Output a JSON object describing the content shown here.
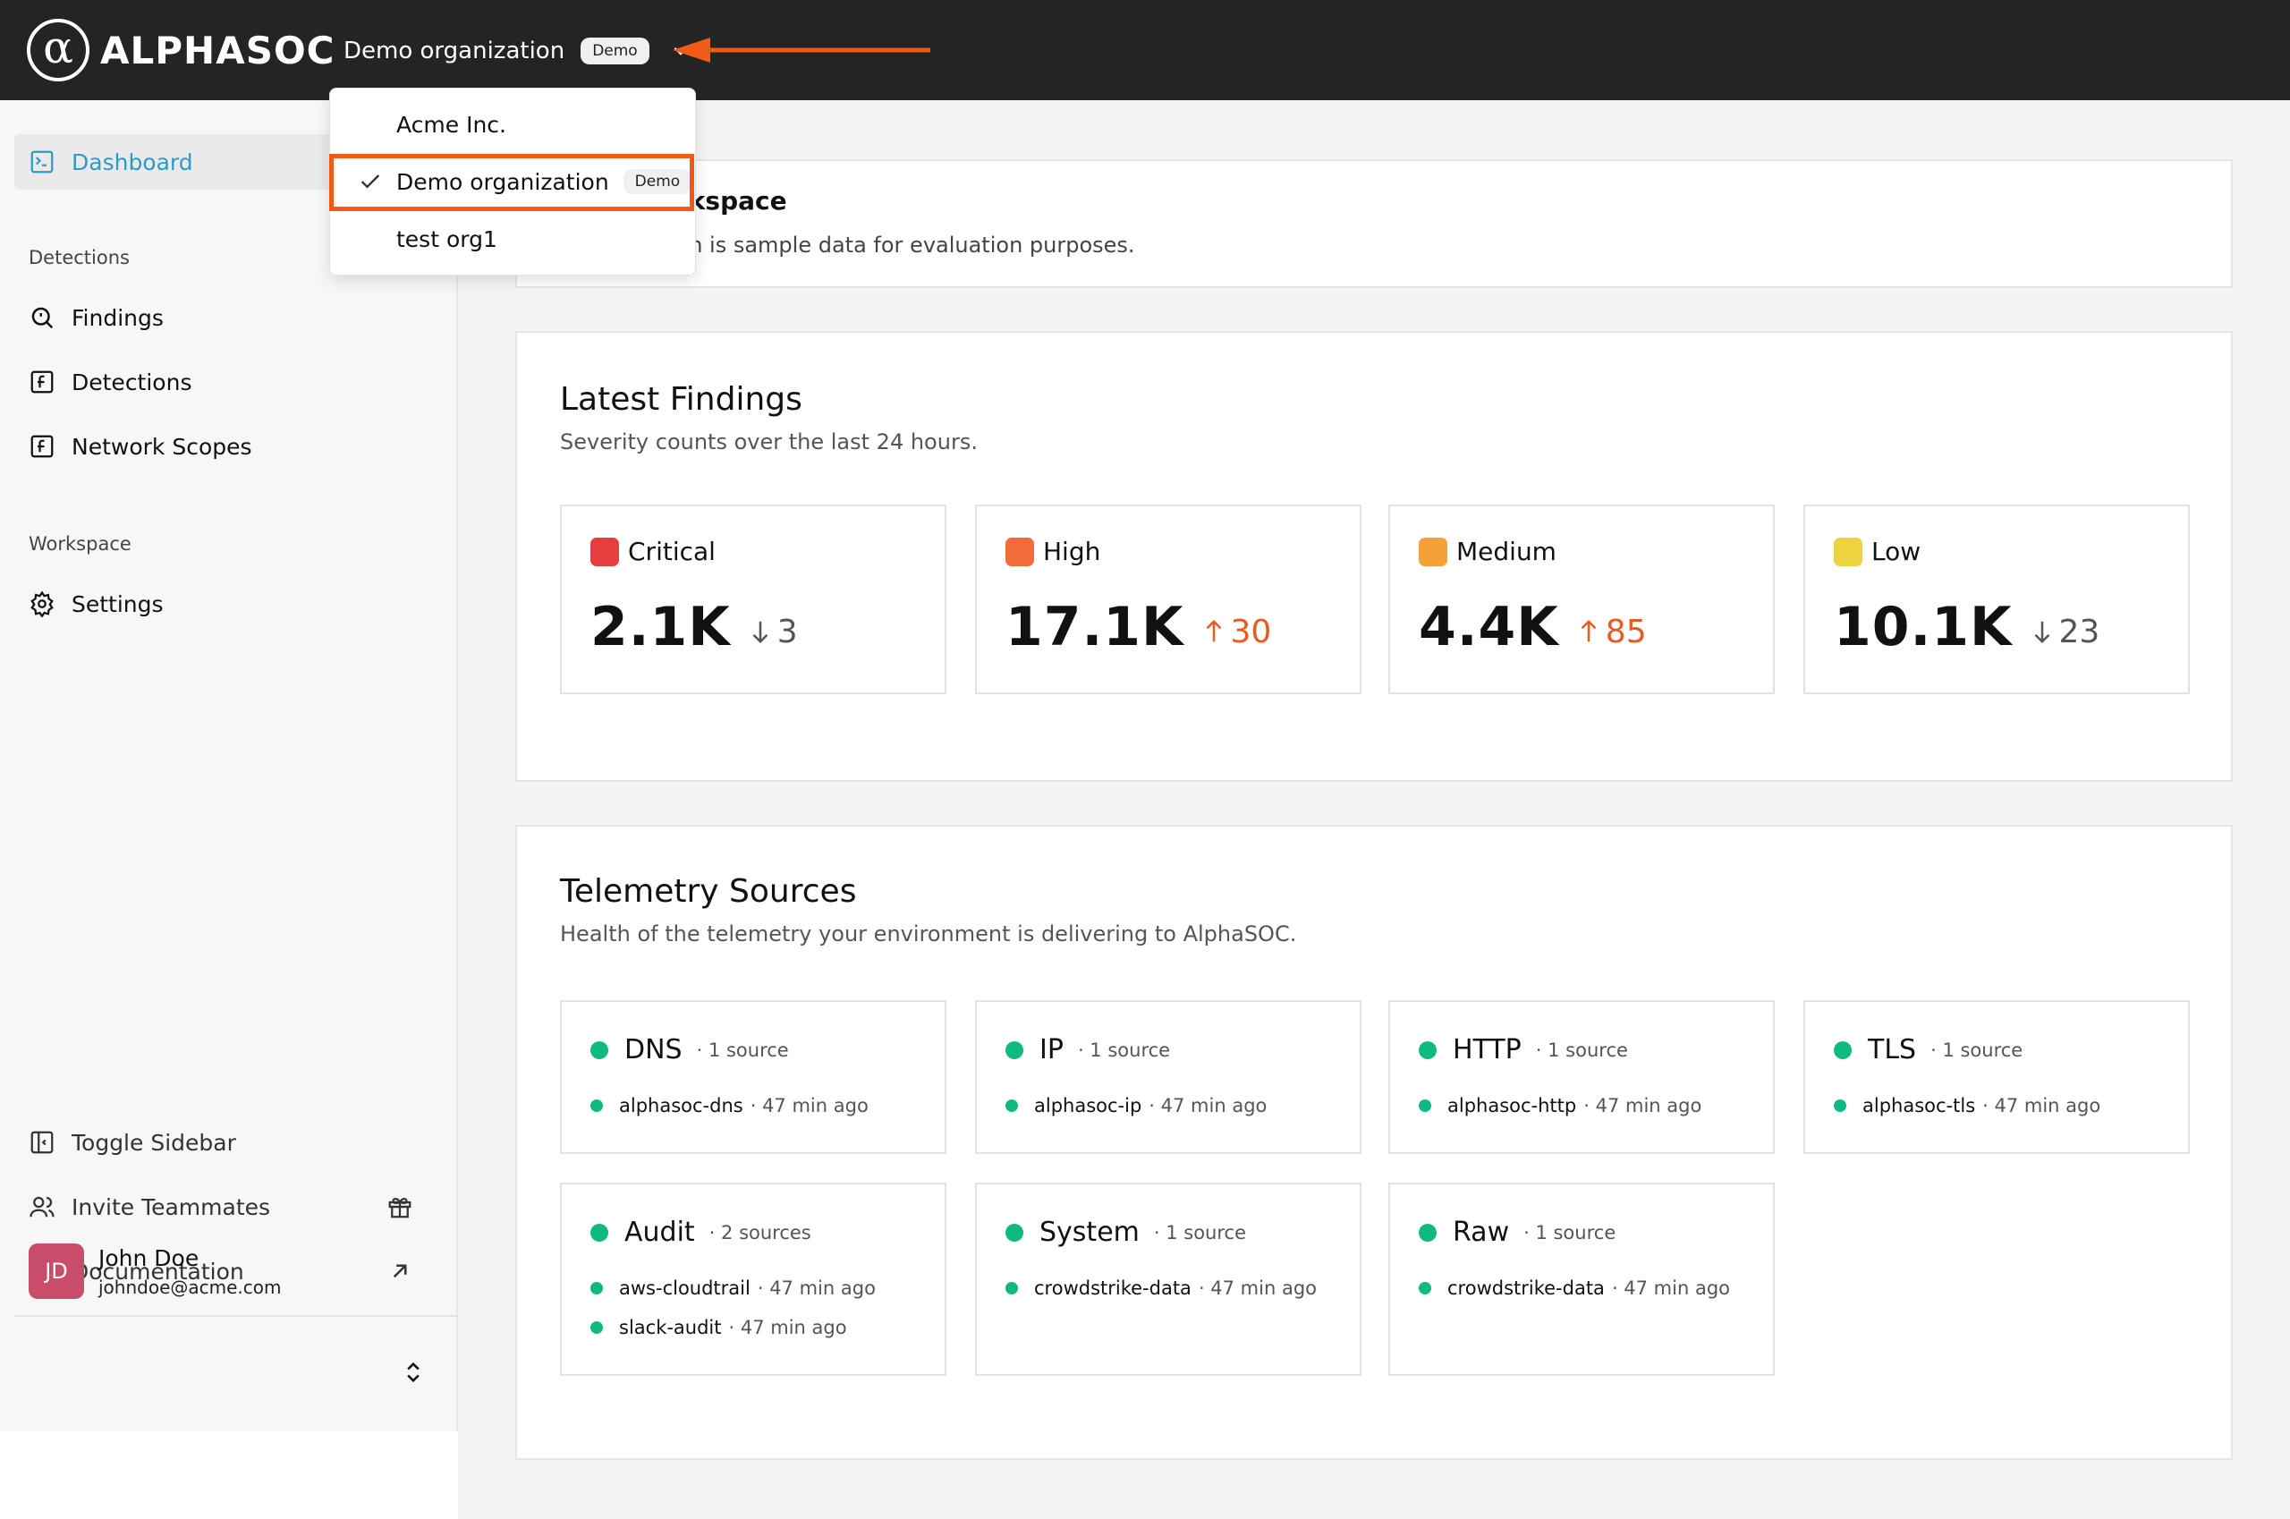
{
  "brand": {
    "name": "ALPHASOC",
    "mark": "α"
  },
  "header": {
    "org_name": "Demo organization",
    "org_badge": "Demo"
  },
  "org_dropdown": {
    "items": [
      {
        "label": "Acme Inc.",
        "badge": "",
        "selected": false
      },
      {
        "label": "Demo organization",
        "badge": "Demo",
        "selected": true
      },
      {
        "label": "test org1",
        "badge": "",
        "selected": false
      }
    ]
  },
  "sidebar": {
    "dashboard": "Dashboard",
    "section_detections": "Detections",
    "findings": "Findings",
    "detections": "Detections",
    "network_scopes": "Network Scopes",
    "section_workspace": "Workspace",
    "settings": "Settings",
    "toggle_sidebar": "Toggle Sidebar",
    "invite_teammates": "Invite Teammates",
    "documentation": "Documentation"
  },
  "user": {
    "initials": "JD",
    "name": "John Doe",
    "email": "johndoe@acme.com"
  },
  "notice": {
    "title_visible": "rkspace",
    "text_visible": "vn is sample data for evaluation purposes."
  },
  "latest_findings": {
    "title": "Latest Findings",
    "subtitle": "Severity counts over the last 24 hours.",
    "cards": [
      {
        "label": "Critical",
        "value": "2.1K",
        "delta": "3",
        "direction": "down",
        "color": "#e53e3e"
      },
      {
        "label": "High",
        "value": "17.1K",
        "delta": "30",
        "direction": "up",
        "color": "#f26b3a"
      },
      {
        "label": "Medium",
        "value": "4.4K",
        "delta": "85",
        "direction": "up",
        "color": "#f5a13a"
      },
      {
        "label": "Low",
        "value": "10.1K",
        "delta": "23",
        "direction": "down",
        "color": "#ecd33f"
      }
    ]
  },
  "telemetry": {
    "title": "Telemetry Sources",
    "subtitle": "Health of the telemetry your environment is delivering to AlphaSOC.",
    "cards": [
      {
        "name": "DNS",
        "count": "· 1 source",
        "sources": [
          {
            "name": "alphasoc-dns",
            "time": "· 47 min ago"
          }
        ]
      },
      {
        "name": "IP",
        "count": "· 1 source",
        "sources": [
          {
            "name": "alphasoc-ip",
            "time": "· 47 min ago"
          }
        ]
      },
      {
        "name": "HTTP",
        "count": "· 1 source",
        "sources": [
          {
            "name": "alphasoc-http",
            "time": "· 47 min ago"
          }
        ]
      },
      {
        "name": "TLS",
        "count": "· 1 source",
        "sources": [
          {
            "name": "alphasoc-tls",
            "time": "· 47 min ago"
          }
        ]
      },
      {
        "name": "Audit",
        "count": "· 2 sources",
        "sources": [
          {
            "name": "aws-cloudtrail",
            "time": "· 47 min ago"
          },
          {
            "name": "slack-audit",
            "time": "· 47 min ago"
          }
        ]
      },
      {
        "name": "System",
        "count": "· 1 source",
        "sources": [
          {
            "name": "crowdstrike-data",
            "time": "· 47 min ago"
          }
        ]
      },
      {
        "name": "Raw",
        "count": "· 1 source",
        "sources": [
          {
            "name": "crowdstrike-data",
            "time": "· 47 min ago"
          }
        ]
      }
    ]
  },
  "colors": {
    "accent": "#2b9bc7",
    "annotation": "#f05a14",
    "healthy": "#10b981",
    "up": "#ea5a1e"
  }
}
